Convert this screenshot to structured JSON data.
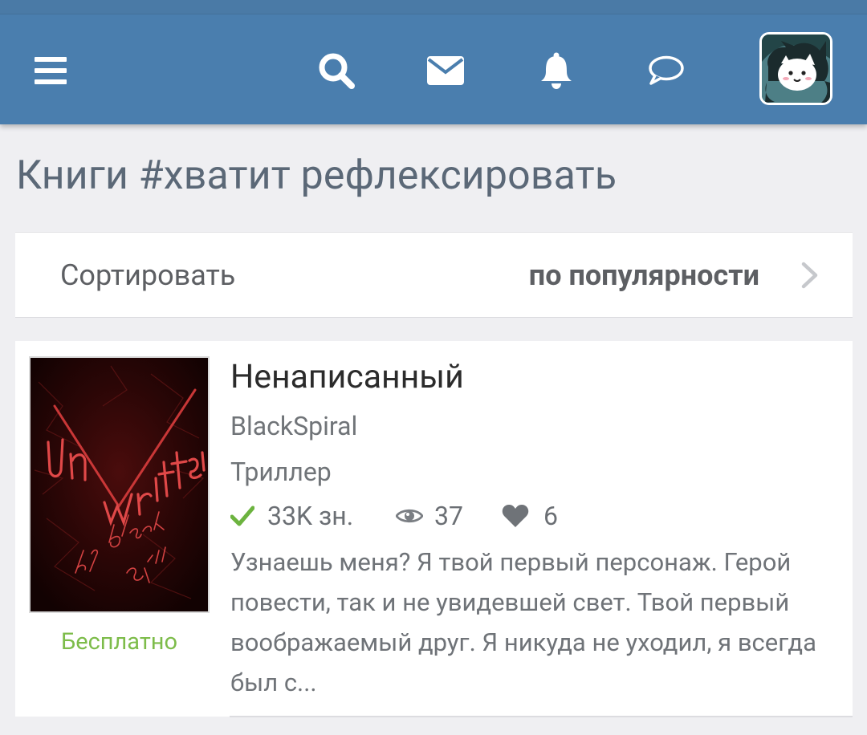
{
  "header": {
    "menu_icon": "hamburger-menu-icon",
    "search_icon": "search-icon",
    "messages_icon": "envelope-icon",
    "notifications_icon": "bell-icon",
    "chat_icon": "speech-bubble-icon",
    "accent_color": "#4a7eae"
  },
  "page": {
    "title": "Книги #хватит рефлексировать"
  },
  "sort": {
    "label": "Сортировать",
    "value": "по популярности"
  },
  "books": [
    {
      "title": "Ненаписанный",
      "author": "BlackSpiral",
      "genre": "Триллер",
      "size": "33K зн.",
      "views": "37",
      "likes": "6",
      "price": "Бесплатно",
      "annotation": "Узнаешь меня? Я твой первый персонаж. Герой повести, так и не увидевшей свет. Твой первый воображаемый друг. Я никуда не уходил, я всегда был с...",
      "cover_text": [
        "Un",
        "Written",
        "by Black Spiral"
      ]
    }
  ],
  "colors": {
    "price_green": "#7dbc4a",
    "check_green": "#6cb33f",
    "page_background": "#efeff2"
  }
}
